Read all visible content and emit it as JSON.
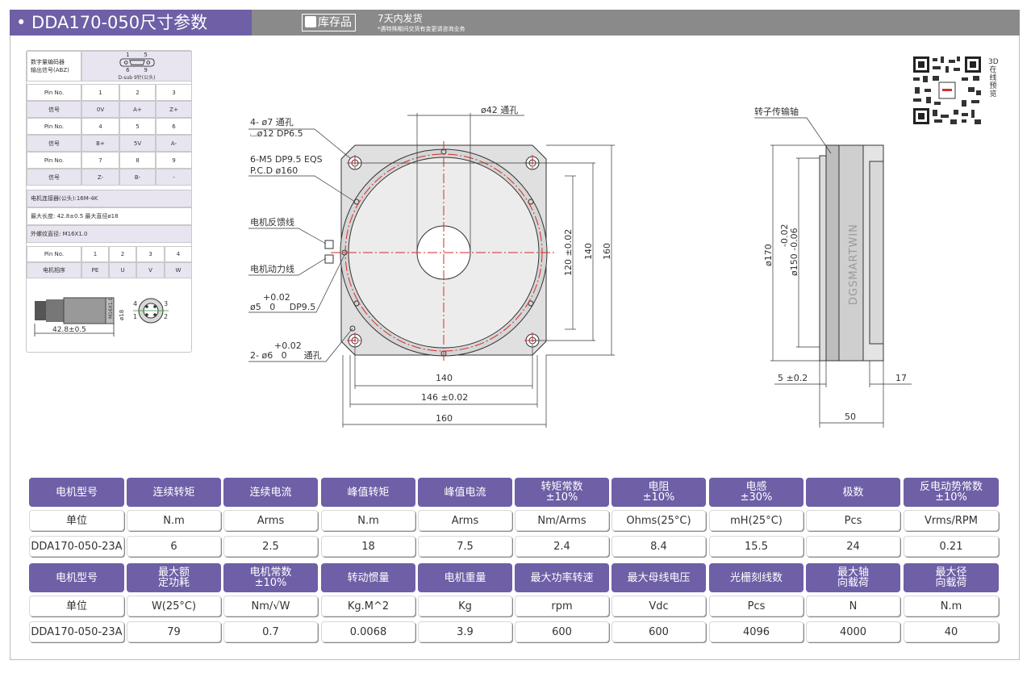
{
  "header": {
    "title": "• DDA170-050尺寸参数",
    "stock_badge": "库存品",
    "stock_icon": "truck-icon",
    "shipping": "7天内发货",
    "shipping_note": "*遇特殊期间交货有变更请咨询业务"
  },
  "encoder": {
    "label_line1": "数字量编码器",
    "label_line2": "输出信号(ABZ)",
    "connector_top": "1        5",
    "connector_bottom": "6        9",
    "connector_caption": "D-sub 9针(公头)",
    "rows": [
      [
        "Pin No.",
        "1",
        "2",
        "3"
      ],
      [
        "信号",
        "0V",
        "A+",
        "Z+"
      ],
      [
        "Pin No.",
        "4",
        "5",
        "6"
      ],
      [
        "信号",
        "B+",
        "5V",
        "A-"
      ],
      [
        "Pin No.",
        "7",
        "8",
        "9"
      ],
      [
        "信号",
        "Z-",
        "B-",
        "-"
      ]
    ]
  },
  "motor_connector": {
    "title": "电机连接器(公头):16M-4K",
    "length": "最大长度: 42.8±0.5   最大直径ø18",
    "thread": "外螺纹直径: M16X1.0",
    "rows": [
      [
        "Pin No.",
        "1",
        "2",
        "3",
        "4"
      ],
      [
        "电机相序",
        "PE",
        "U",
        "V",
        "W"
      ]
    ],
    "dims": {
      "length": "42.8±0.5",
      "thread": "M16X1.0",
      "diameter": "ø18",
      "pin4": "4",
      "pin3": "3",
      "pin1": "1",
      "pin2": "2"
    }
  },
  "drawing": {
    "hole_label1": "4- ø7 通孔",
    "hole_label2": "⌴ø12 DP6.5",
    "tap_label1": "6-M5 DP9.5 EQS",
    "tap_label2": "P.C.D ø160",
    "feedback": "电机反馈线",
    "power": "电机动力线",
    "pin_tol": "+0.02",
    "pin_label": "ø5   0     DP9.5",
    "pin2_tol": "+0.02",
    "pin2_label": "2- ø6   0      通孔",
    "bore": "ø42 通孔",
    "dim_120": "120 ±0.02",
    "dim_140v": "140",
    "dim_160v": "160",
    "dim_140h": "140",
    "dim_146": "146 ±0.02",
    "dim_160h": "160"
  },
  "side_view": {
    "shaft_label": "转子传输轴",
    "dia170": "ø170",
    "dia150": "ø150 -0.06",
    "dia150_tol": "-0.02",
    "dim_5": "5 ±0.2",
    "dim_17": "17",
    "dim_50": "50",
    "brand": "DGSMARTWIN"
  },
  "qr": {
    "text": "3D在线预览",
    "icon": "qr-code-icon"
  },
  "spec_table": {
    "rows": [
      {
        "kind": "head",
        "cells": [
          "电机型号",
          "连续转矩",
          "连续电流",
          "峰值转矩",
          "峰值电流",
          "转矩常数\n±10%",
          "电阻\n±10%",
          "电感\n±30%",
          "极数",
          "反电动势常数\n±10%"
        ]
      },
      {
        "kind": "val",
        "cells": [
          "单位",
          "N.m",
          "Arms",
          "N.m",
          "Arms",
          "Nm/Arms",
          "Ohms(25°C)",
          "mH(25°C)",
          "Pcs",
          "Vrms/RPM"
        ]
      },
      {
        "kind": "val",
        "cells": [
          "DDA170-050-23A",
          "6",
          "2.5",
          "18",
          "7.5",
          "2.4",
          "8.4",
          "15.5",
          "24",
          "0.21"
        ]
      },
      {
        "kind": "head",
        "cells": [
          "电机型号",
          "最大额\n定功耗",
          "电机常数\n±10%",
          "转动惯量",
          "电机重量",
          "最大功率转速",
          "最大母线电压",
          "光栅刻线数",
          "最大轴\n向载荷",
          "最大径\n向载荷"
        ]
      },
      {
        "kind": "val",
        "cells": [
          "单位",
          "W(25°C)",
          "Nm/√W",
          "Kg.M^2",
          "Kg",
          "rpm",
          "Vdc",
          "Pcs",
          "N",
          "N.m"
        ]
      },
      {
        "kind": "val",
        "cells": [
          "DDA170-050-23A",
          "79",
          "0.7",
          "0.0068",
          "3.9",
          "600",
          "600",
          "4096",
          "4000",
          "40"
        ]
      }
    ]
  },
  "colors": {
    "accent": "#6e5fa6",
    "header_bar": "#8a8a8a",
    "centerline": "#d62a2a"
  }
}
